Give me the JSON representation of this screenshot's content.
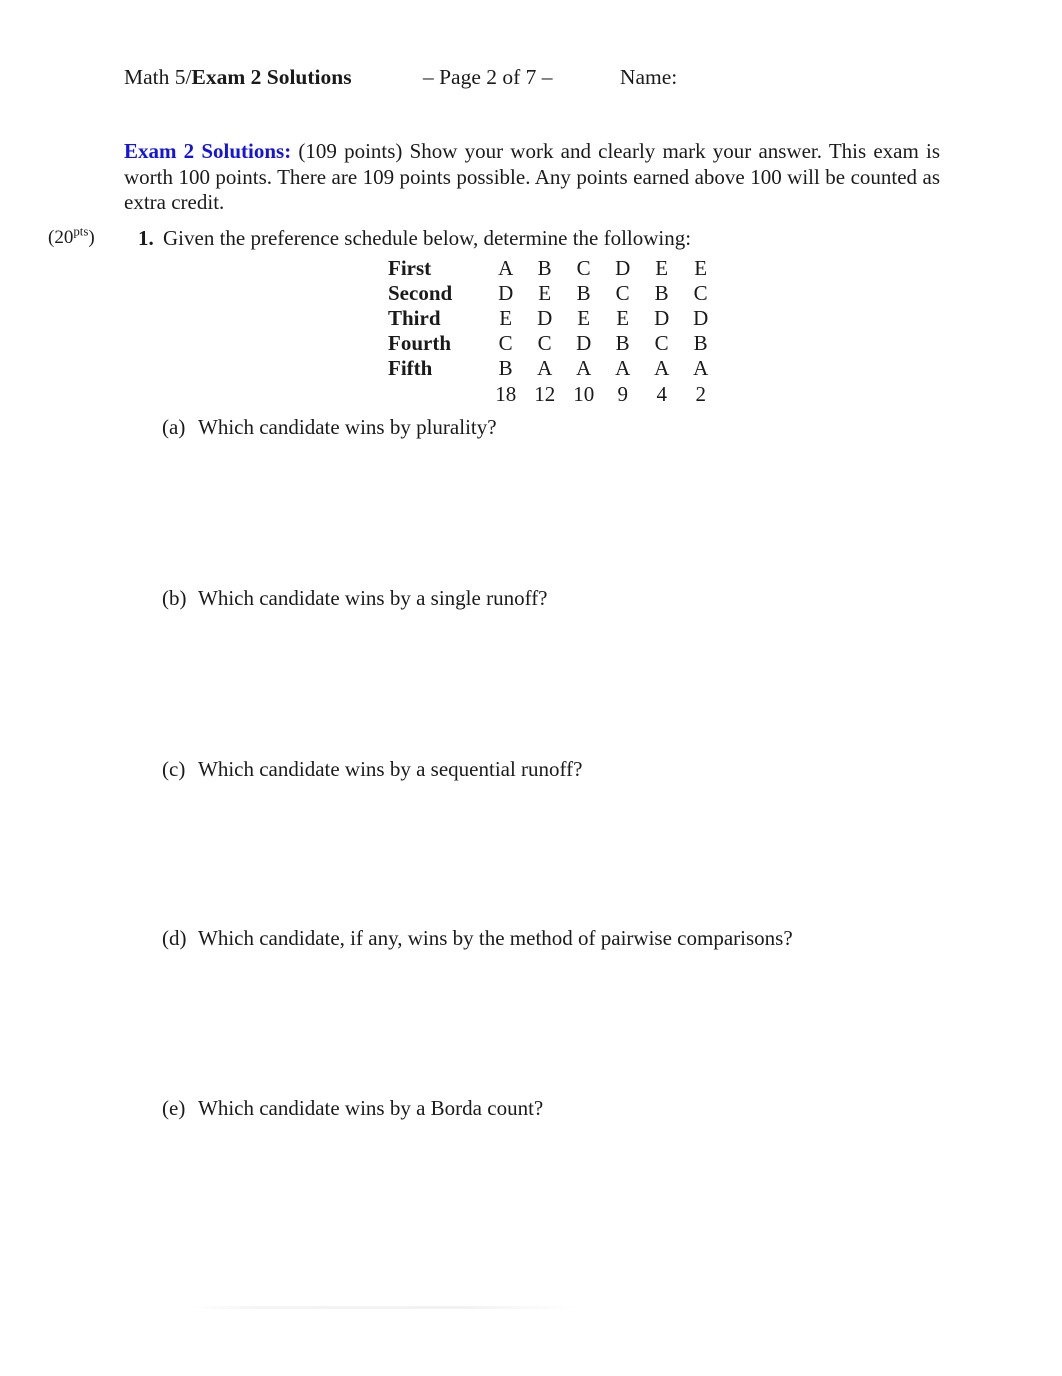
{
  "header": {
    "course": "Math 5/",
    "exam_title": "Exam 2 Solutions",
    "page_indicator": "– Page 2 of 7 –",
    "name_label": "Name:"
  },
  "intro": {
    "lead": "Exam 2 Solutions:",
    "body": "(109 points) Show your work and clearly mark your answer. This exam is worth 100 points. There are 109 points possible. Any points earned above 100 will be counted as extra credit."
  },
  "problem": {
    "points_value": "(20",
    "points_sup": "pts",
    "points_close": ")",
    "number": "1.",
    "stem": "Given the preference schedule below, determine the following:",
    "preference_schedule": {
      "rank_labels": [
        "First",
        "Second",
        "Third",
        "Fourth",
        "Fifth"
      ],
      "columns": [
        {
          "votes": "18",
          "ballot": [
            "A",
            "D",
            "E",
            "C",
            "B"
          ]
        },
        {
          "votes": "12",
          "ballot": [
            "B",
            "E",
            "D",
            "C",
            "A"
          ]
        },
        {
          "votes": "10",
          "ballot": [
            "C",
            "B",
            "E",
            "D",
            "A"
          ]
        },
        {
          "votes": "9",
          "ballot": [
            "D",
            "C",
            "E",
            "B",
            "A"
          ]
        },
        {
          "votes": "4",
          "ballot": [
            "E",
            "B",
            "D",
            "C",
            "A"
          ]
        },
        {
          "votes": "2",
          "ballot": [
            "E",
            "C",
            "D",
            "B",
            "A"
          ]
        }
      ],
      "rows": [
        {
          "label": "First",
          "cells": [
            "A",
            "B",
            "C",
            "D",
            "E",
            "E"
          ]
        },
        {
          "label": "Second",
          "cells": [
            "D",
            "E",
            "B",
            "C",
            "B",
            "C"
          ]
        },
        {
          "label": "Third",
          "cells": [
            "E",
            "D",
            "E",
            "E",
            "D",
            "D"
          ]
        },
        {
          "label": "Fourth",
          "cells": [
            "C",
            "C",
            "D",
            "B",
            "C",
            "B"
          ]
        },
        {
          "label": "Fifth",
          "cells": [
            "B",
            "A",
            "A",
            "A",
            "A",
            "A"
          ]
        }
      ],
      "counts_row": [
        "18",
        "12",
        "10",
        "9",
        "4",
        "2"
      ]
    },
    "subparts": [
      {
        "tag": "(a)",
        "text": "Which candidate wins by plurality?"
      },
      {
        "tag": "(b)",
        "text": "Which candidate wins by a single runoff?"
      },
      {
        "tag": "(c)",
        "text": "Which candidate wins by a sequential runoff?"
      },
      {
        "tag": "(d)",
        "text": "Which candidate, if any, wins by the method of pairwise comparisons?"
      },
      {
        "tag": "(e)",
        "text": "Which candidate wins by a Borda count?"
      }
    ]
  },
  "colors": {
    "heading_blue": "#1414e0",
    "body_text": "#1a1a1a",
    "page_background": "#ffffff"
  }
}
